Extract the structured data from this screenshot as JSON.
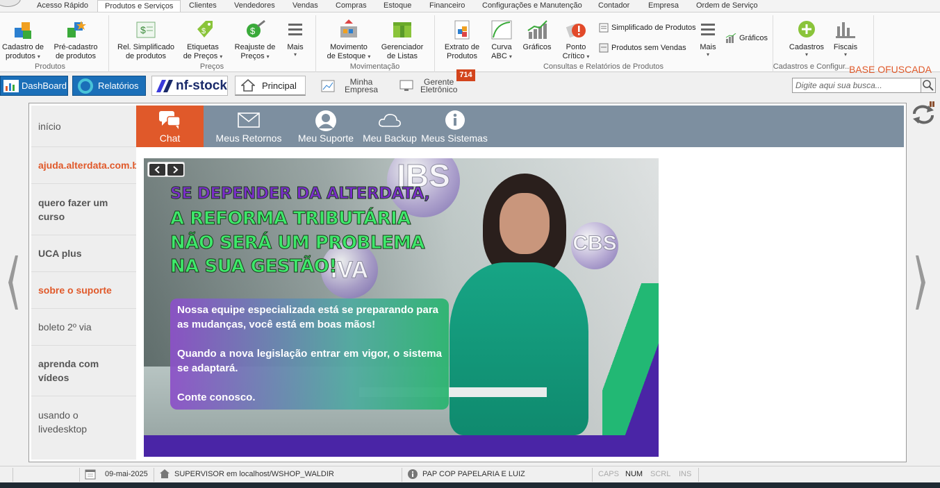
{
  "menu": {
    "tabs": [
      "Acesso Rápido",
      "Produtos e Serviços",
      "Clientes",
      "Vendedores",
      "Vendas",
      "Compras",
      "Estoque",
      "Financeiro",
      "Configurações e Manutenção",
      "Contador",
      "Empresa",
      "Ordem de Serviço"
    ]
  },
  "ribbon": {
    "items": [
      {
        "line1": "Cadastro de",
        "line2": "produtos"
      },
      {
        "line1": "Pré-cadastro",
        "line2": "de produtos"
      },
      {
        "line1": "Rel. Simplificado",
        "line2": "de produtos"
      },
      {
        "line1": "Etiquetas",
        "line2": "de Preços"
      },
      {
        "line1": "Reajuste de",
        "line2": "Preços"
      },
      {
        "line1": "Mais",
        "line2": ""
      },
      {
        "line1": "Movimento",
        "line2": "de Estoque"
      },
      {
        "line1": "Gerenciador",
        "line2": "de Listas"
      },
      {
        "line1": "Extrato de",
        "line2": "Produtos"
      },
      {
        "line1": "Curva",
        "line2": "ABC"
      },
      {
        "line1": "Gráficos",
        "line2": ""
      },
      {
        "line1": "Ponto",
        "line2": "Crítico"
      },
      {
        "line1": "Mais",
        "line2": ""
      },
      {
        "line1": "Cadastros",
        "line2": ""
      },
      {
        "line1": "Fiscais",
        "line2": ""
      }
    ],
    "small": {
      "simplificado": "Simplificado de Produtos",
      "sem_vendas": "Produtos sem Vendas",
      "graficos": "Gráficos"
    },
    "groups": {
      "produtos": "Produtos",
      "precos": "Preços",
      "movimentacao": "Movimentação",
      "consultas": "Consultas e Relatórios de Produtos",
      "cadastros": "Cadastros e Configur..."
    },
    "watermark": "BASE OFUSCADA"
  },
  "quickbar": {
    "dashboard": "DashBoard",
    "relatorios": "Relatórios",
    "nfstock": "nf-stock",
    "principal": "Principal",
    "minha_empresa_1": "Minha",
    "minha_empresa_2": "Empresa",
    "gerente_1": "Gerente",
    "gerente_2": "Eletrônico",
    "gerente_badge": "714",
    "search_placeholder": "Digite aqui sua busca..."
  },
  "sidenav": {
    "items": [
      "início",
      "ajuda.alterdata.com.br",
      "quero fazer um curso",
      "UCA plus",
      "sobre o suporte",
      "boleto 2º via",
      "aprenda com vídeos",
      "usando o livedesktop"
    ]
  },
  "topnav": {
    "items": [
      "Chat",
      "Meus Retornos",
      "Meu Suporte",
      "Meu Backup",
      "Meus Sistemas"
    ]
  },
  "banner": {
    "headline1": "SE DEPENDER DA ALTERDATA,",
    "headline2": "A REFORMA TRIBUTÁRIA",
    "headline3": "NÃO SERÁ UM PROBLEMA",
    "headline4": "NA SUA GESTÃO!",
    "msg1": "Nossa equipe especializada está se preparando para as mudanças, você está em boas mãos!",
    "msg2": "Quando a nova legislação entrar em vigor, o sistema se adaptará.",
    "msg3": "Conte conosco.",
    "bubble_ibs": "IBS",
    "bubble_cbs": "CBS",
    "bubble_iva": "IVA"
  },
  "statusbar": {
    "date": "09-mai-2025",
    "user": "SUPERVISOR em localhost/WSHOP_WALDIR",
    "company": "PAP COP PAPELARIA E LUIZ",
    "caps": "CAPS",
    "num": "NUM",
    "scrl": "SCRL",
    "ins": "INS"
  },
  "colors": {
    "accent_orange": "#e0592a",
    "nav_gray": "#7d8fa0",
    "dashboard_blue": "#1b6fb8",
    "banner_purple": "#4a25a6",
    "headline_green": "#3ee86a",
    "headline_purple": "#7a2ec8"
  }
}
